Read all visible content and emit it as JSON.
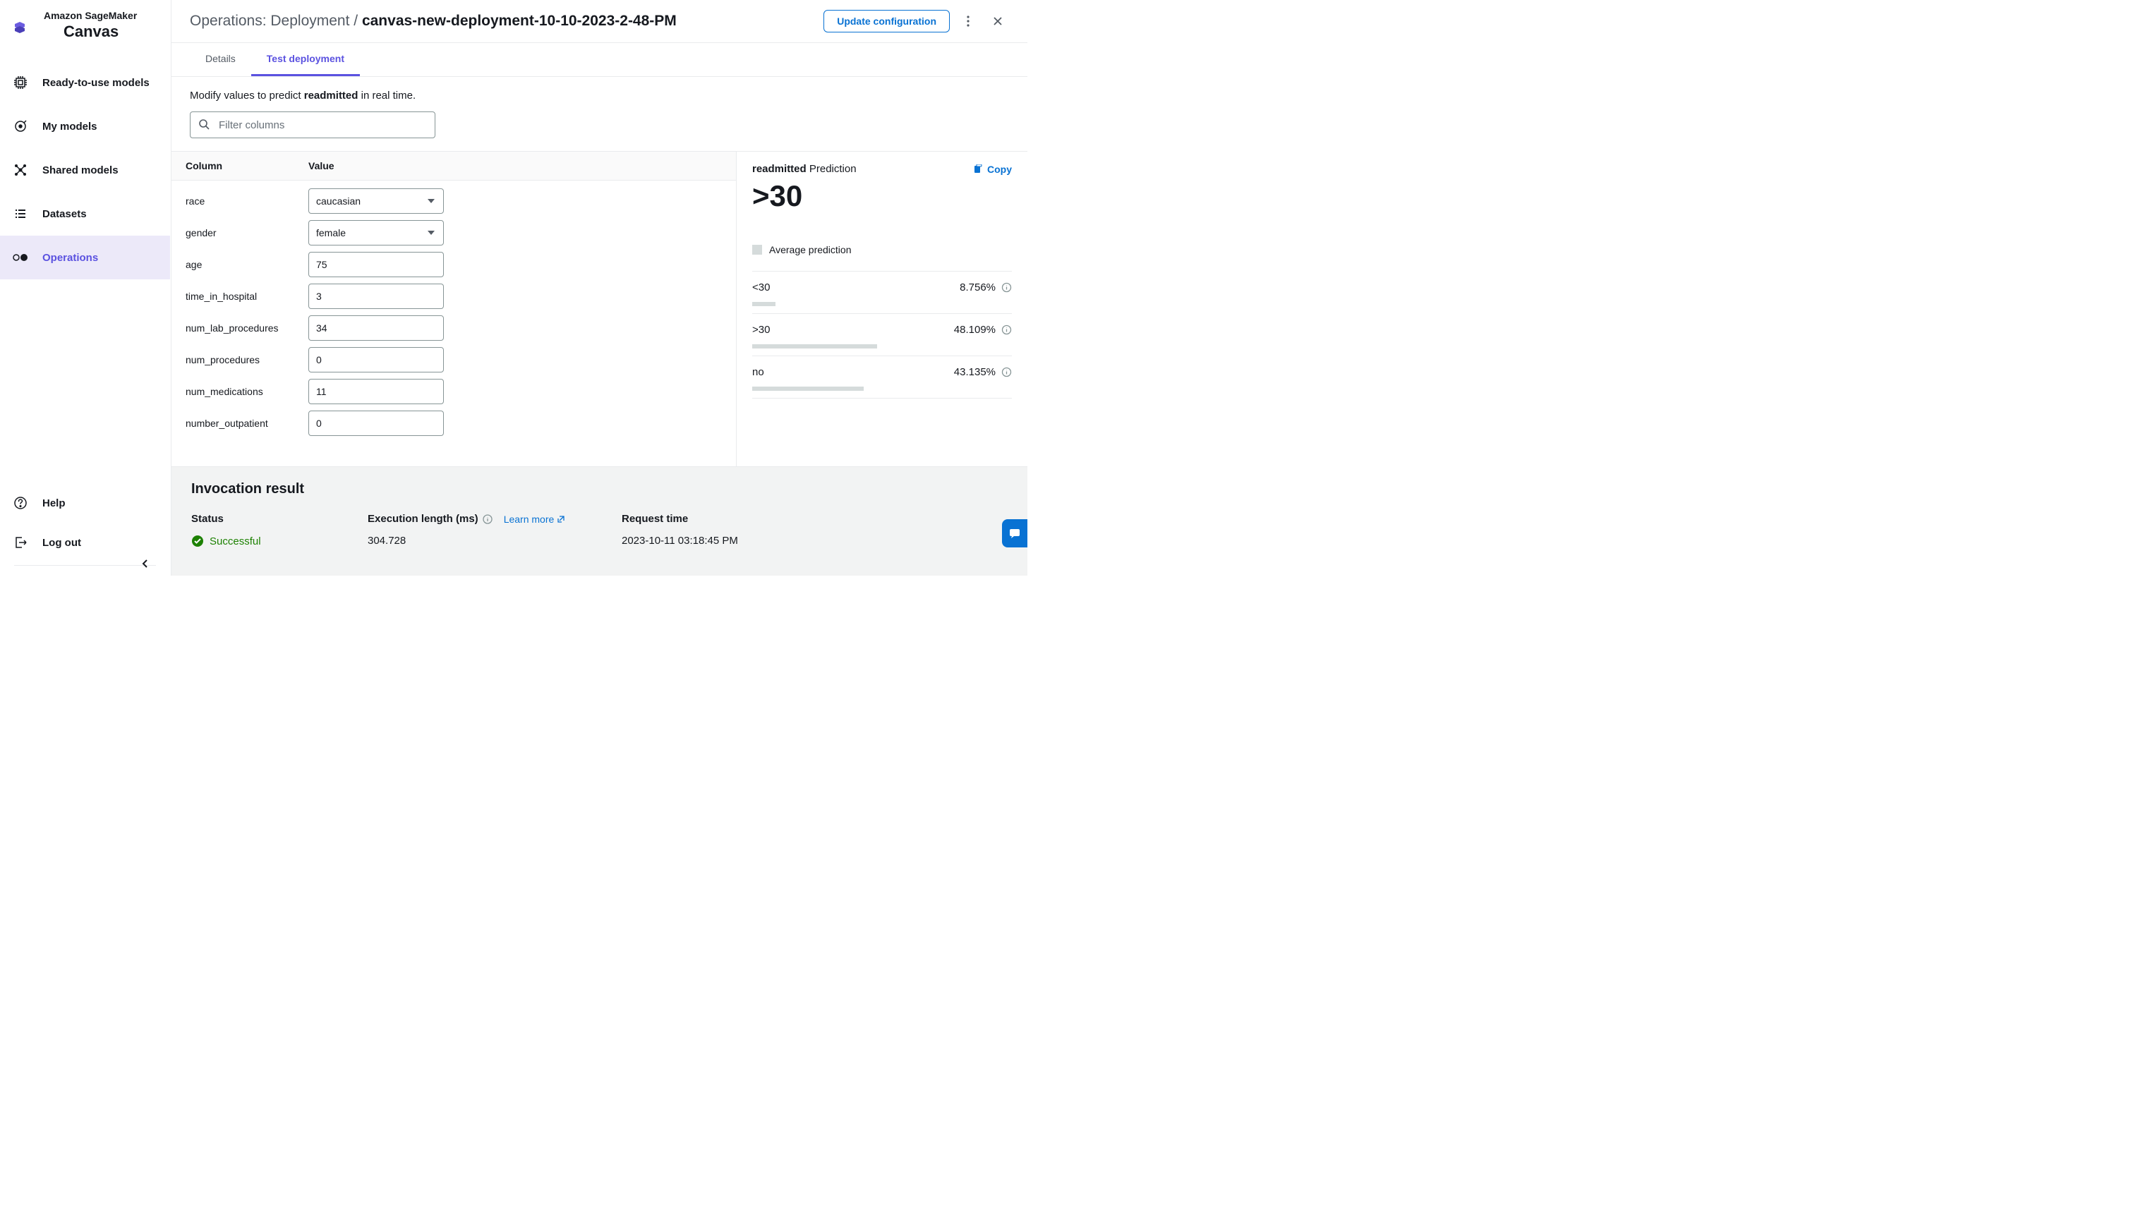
{
  "sidebar": {
    "sup": "Amazon SageMaker",
    "title": "Canvas",
    "items": [
      {
        "label": "Ready-to-use models"
      },
      {
        "label": "My models"
      },
      {
        "label": "Shared models"
      },
      {
        "label": "Datasets"
      },
      {
        "label": "Operations"
      }
    ],
    "help": "Help",
    "logout": "Log out"
  },
  "header": {
    "crumb": "Operations: Deployment / ",
    "name": "canvas-new-deployment-10-10-2023-2-48-PM",
    "update": "Update configuration"
  },
  "tabs": {
    "details": "Details",
    "test": "Test deployment"
  },
  "instr_pre": "Modify values to predict ",
  "instr_b": "readmitted",
  "instr_post": " in real time.",
  "search_placeholder": "Filter columns",
  "table": {
    "colh": "Column",
    "valh": "Value",
    "rows": [
      {
        "label": "race",
        "type": "select",
        "value": "caucasian"
      },
      {
        "label": "gender",
        "type": "select",
        "value": "female"
      },
      {
        "label": "age",
        "type": "text",
        "value": "75"
      },
      {
        "label": "time_in_hospital",
        "type": "text",
        "value": "3"
      },
      {
        "label": "num_lab_procedures",
        "type": "text",
        "value": "34"
      },
      {
        "label": "num_procedures",
        "type": "text",
        "value": "0"
      },
      {
        "label": "num_medications",
        "type": "text",
        "value": "11"
      },
      {
        "label": "number_outpatient",
        "type": "text",
        "value": "0"
      }
    ]
  },
  "pred": {
    "label": "readmitted",
    "suffix": " Prediction",
    "copy": "Copy",
    "value": ">30",
    "avg": "Average prediction",
    "probs": [
      {
        "name": "<30",
        "pct": "8.756%",
        "w": 9
      },
      {
        "name": ">30",
        "pct": "48.109%",
        "w": 48
      },
      {
        "name": "no",
        "pct": "43.135%",
        "w": 43
      }
    ]
  },
  "footer": {
    "title": "Invocation result",
    "status_h": "Status",
    "status_v": "Successful",
    "exec_h": "Execution length (ms)",
    "exec_v": "304.728",
    "learn": "Learn more",
    "req_h": "Request time",
    "req_v": "2023-10-11 03:18:45 PM"
  },
  "chart_data": {
    "type": "bar",
    "title": "readmitted Prediction",
    "categories": [
      "<30",
      ">30",
      "no"
    ],
    "values": [
      8.756,
      48.109,
      43.135
    ],
    "ylabel": "%",
    "ylim": [
      0,
      100
    ]
  }
}
